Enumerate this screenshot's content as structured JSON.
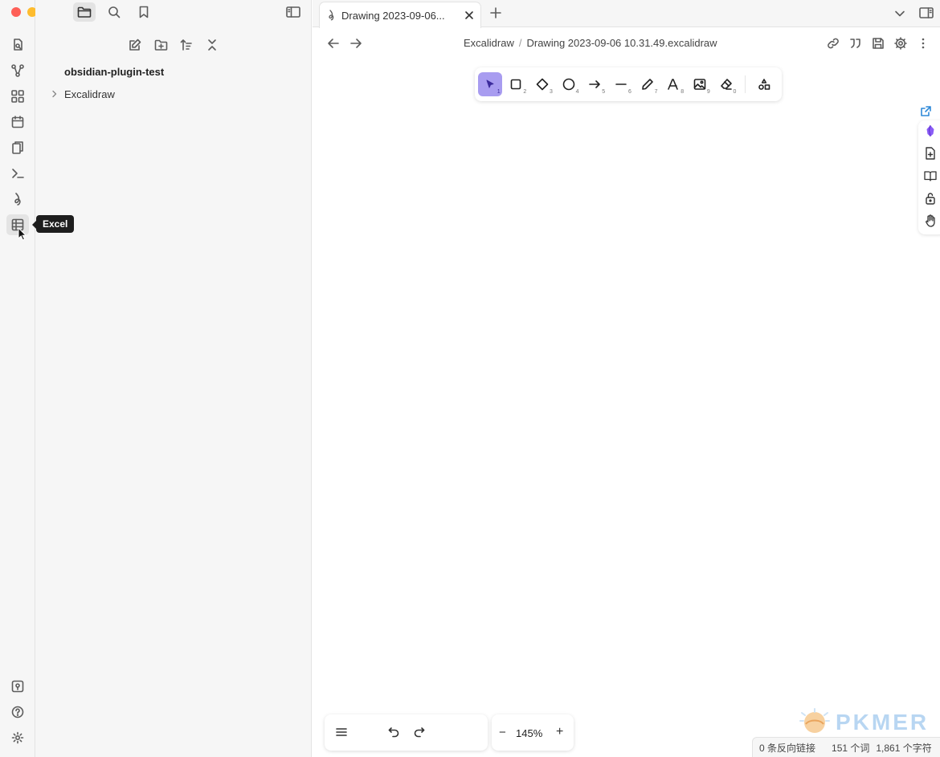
{
  "window": {
    "traffic_lights": [
      "#fe5f57",
      "#febc2e",
      "#28c840"
    ]
  },
  "sidebar": {
    "vault_name": "obsidian-plugin-test",
    "tree": [
      {
        "label": "Excalidraw",
        "collapsed": true
      }
    ],
    "tooltip": "Excel"
  },
  "tab": {
    "title": "Drawing 2023-09-06..."
  },
  "breadcrumb": {
    "folder": "Excalidraw",
    "separator": "/",
    "file": "Drawing 2023-09-06 10.31.49.excalidraw"
  },
  "toolbar": {
    "accent": "#a89cf0",
    "tools": [
      {
        "icon": "pointer-icon",
        "key": "1",
        "active": true
      },
      {
        "icon": "rectangle-icon",
        "key": "2"
      },
      {
        "icon": "diamond-icon",
        "key": "3"
      },
      {
        "icon": "ellipse-icon",
        "key": "4"
      },
      {
        "icon": "arrow-icon",
        "key": "5"
      },
      {
        "icon": "line-icon",
        "key": "6"
      },
      {
        "icon": "pencil-icon",
        "key": "7"
      },
      {
        "icon": "text-icon",
        "key": "8"
      },
      {
        "icon": "image-icon",
        "key": "9"
      },
      {
        "icon": "eraser-icon",
        "key": "0"
      }
    ]
  },
  "zoom": {
    "value": "145%",
    "minus": "−",
    "plus": "+"
  },
  "status": {
    "backlinks": "0 条反向链接",
    "words": "151 个词",
    "chars": "1,861 个字符"
  },
  "watermark": "PKMER"
}
